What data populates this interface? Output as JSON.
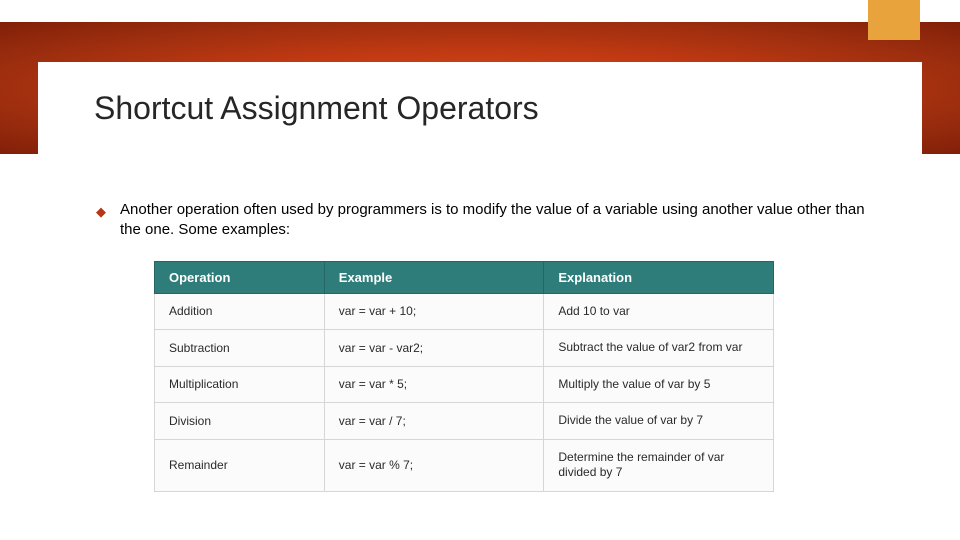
{
  "slide": {
    "title": "Shortcut Assignment Operators",
    "bullet": "Another operation often used by programmers is to modify the value of a variable using another value other than the one. Some examples:"
  },
  "table": {
    "headers": {
      "operation": "Operation",
      "example": "Example",
      "explanation": "Explanation"
    },
    "rows": [
      {
        "operation": "Addition",
        "example": "var = var + 10;",
        "explanation": "Add 10 to var"
      },
      {
        "operation": "Subtraction",
        "example": "var = var - var2;",
        "explanation": "Subtract the value of var2 from var"
      },
      {
        "operation": "Multiplication",
        "example": "var = var * 5;",
        "explanation": "Multiply the value of var by 5"
      },
      {
        "operation": "Division",
        "example": "var = var / 7;",
        "explanation": "Divide the value of var by 7"
      },
      {
        "operation": "Remainder",
        "example": "var = var % 7;",
        "explanation": "Determine the remainder of var divided by 7"
      }
    ]
  }
}
